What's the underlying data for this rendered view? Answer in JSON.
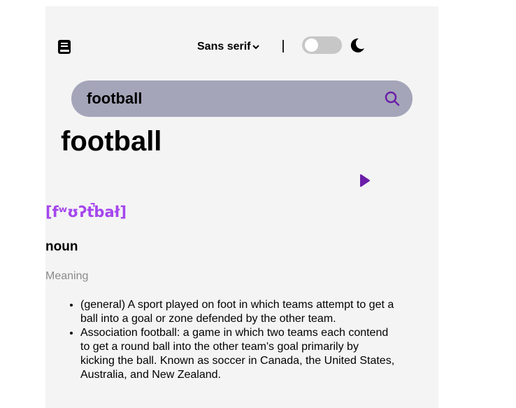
{
  "header": {
    "font_selector_label": "Sans serif",
    "logo_icon": "book-icon",
    "theme_icon": "moon-icon"
  },
  "search": {
    "value": "football",
    "placeholder": ""
  },
  "word": {
    "title": "football",
    "phonetic": "[fʷʊʔt̚bał]",
    "part_of_speech": "noun",
    "meaning_label": "Meaning",
    "definitions": [
      "(general) A sport played on foot in which teams attempt to get a ball into a goal or zone defended by the other team.",
      "Association football: a game in which two teams each contend to get a round ball into the other team's goal primarily by kicking the ball. Known as soccer in Canada, the United States, Australia, and New Zealand."
    ]
  },
  "colors": {
    "accent": "#a445ed",
    "search_bg": "#a4a5b9",
    "panel_bg": "#f4f4f4",
    "toggle_bg": "#c7c7c7"
  }
}
